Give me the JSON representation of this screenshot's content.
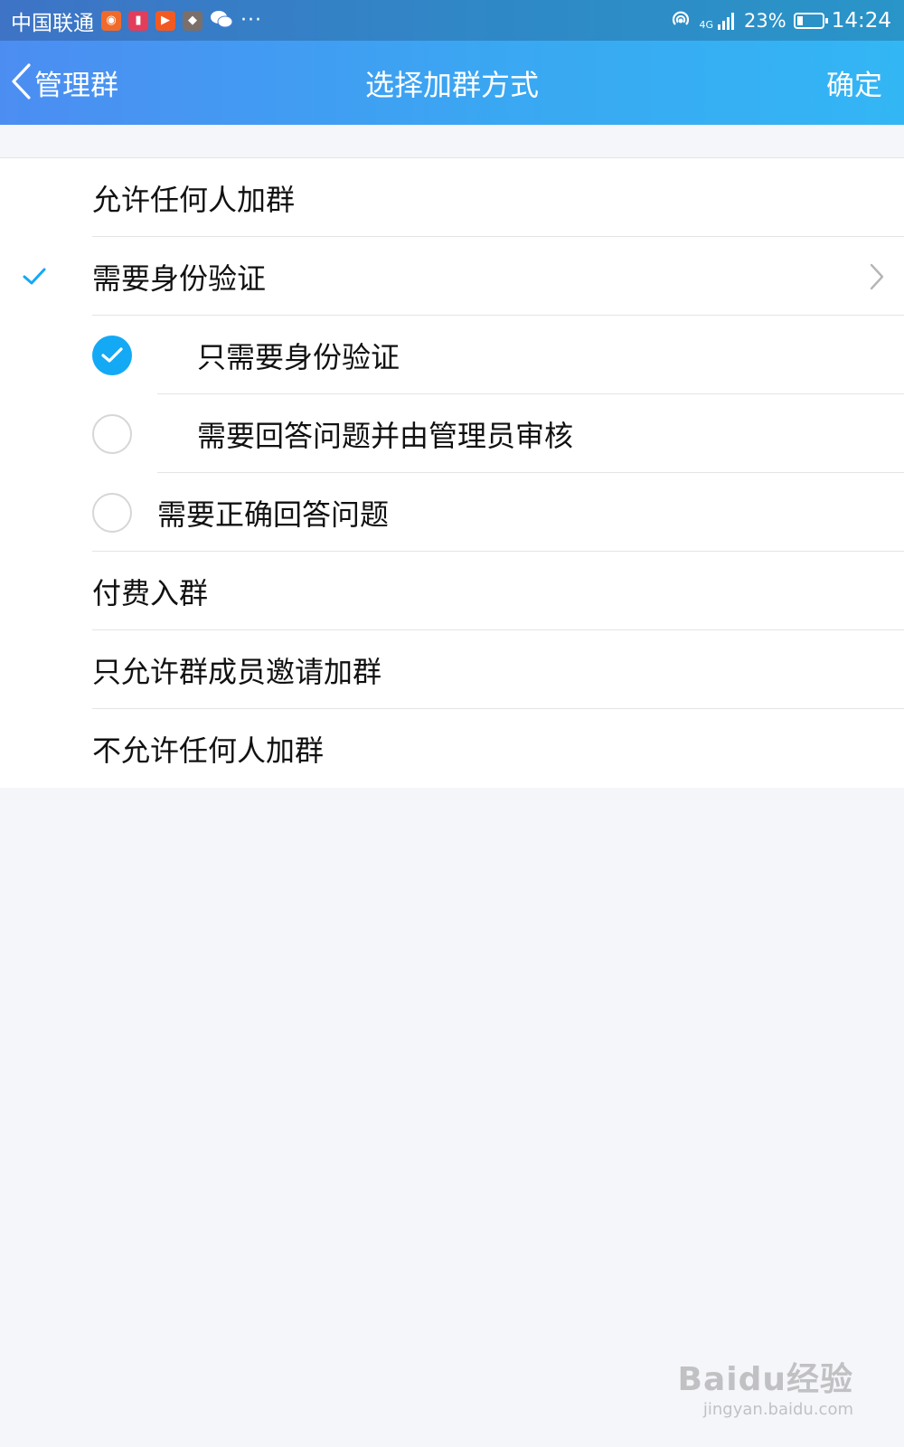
{
  "status_bar": {
    "carrier": "中国联通",
    "network": "4G",
    "battery": "23%",
    "battery_level": 0.23,
    "time": "14:24",
    "more": "···"
  },
  "nav": {
    "back_label": "管理群",
    "title": "选择加群方式",
    "confirm_label": "确定"
  },
  "options": [
    {
      "label": "允许任何人加群"
    },
    {
      "label": "需要身份验证",
      "selected": true
    },
    {
      "label": "付费入群"
    },
    {
      "label": "只允许群成员邀请加群"
    },
    {
      "label": "不允许任何人加群"
    }
  ],
  "verification_sub_options": [
    {
      "label": "只需要身份验证",
      "checked": true
    },
    {
      "label": "需要回答问题并由管理员审核",
      "checked": false
    },
    {
      "label": "需要正确回答问题",
      "checked": false
    }
  ],
  "colors": {
    "accent": "#14a9f5",
    "nav_gradient_start": "#4c8df2",
    "nav_gradient_end": "#33b6f4",
    "background": "#f5f6fa"
  },
  "watermark": {
    "brand": "Baidu经验",
    "url": "jingyan.baidu.com"
  }
}
